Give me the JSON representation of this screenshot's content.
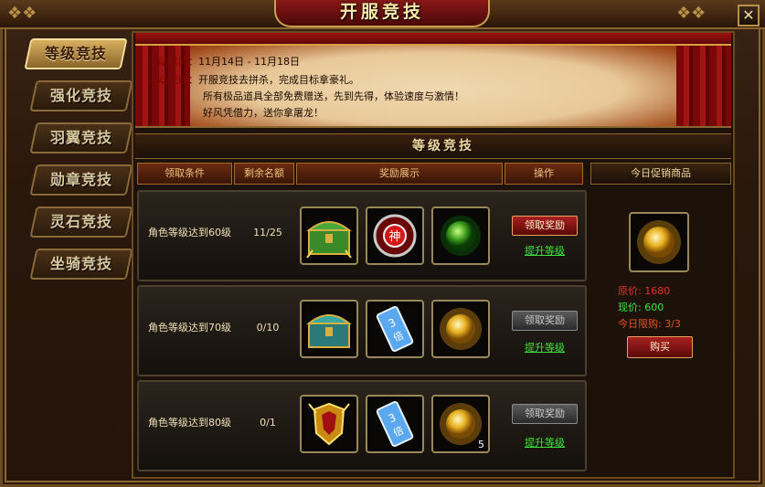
{
  "window": {
    "title": "开服竞技",
    "close": "✕"
  },
  "tabs": [
    {
      "label": "等级竞技",
      "active": true
    },
    {
      "label": "强化竞技"
    },
    {
      "label": "羽翼竞技"
    },
    {
      "label": "勋章竞技"
    },
    {
      "label": "灵石竞技"
    },
    {
      "label": "坐骑竞技"
    }
  ],
  "banner": {
    "time_label": "活动时间：",
    "time_value": "11月14日 - 11月18日",
    "desc_label": "活动说明：",
    "desc_lines": [
      "开服竞技去拼杀，完成目标拿豪礼。",
      "所有极品道具全部免费赠送，先到先得，体验速度与激情！",
      "好风凭借力，送你拿屠龙！"
    ]
  },
  "section": {
    "title": "等级竞技"
  },
  "columns": [
    "领取条件",
    "剩余名额",
    "奖励展示",
    "操作"
  ],
  "rows": [
    {
      "condition": "角色等级达到60级",
      "remaining": "11/25",
      "rewards": [
        {
          "icon": "green-treasure-chest-icon"
        },
        {
          "icon": "red-god-seal-icon"
        },
        {
          "icon": "green-orb-icon"
        }
      ],
      "claim_label": "领取奖励",
      "claim_enabled": true,
      "upgrade_label": "提升等级"
    },
    {
      "condition": "角色等级达到70级",
      "remaining": "0/10",
      "rewards": [
        {
          "icon": "cyan-treasure-chest-icon"
        },
        {
          "icon": "triple-exp-card-icon"
        },
        {
          "icon": "golden-orb-icon"
        }
      ],
      "claim_label": "领取奖励",
      "claim_enabled": false,
      "upgrade_label": "提升等级"
    },
    {
      "condition": "角色等级达到80级",
      "remaining": "0/1",
      "rewards": [
        {
          "icon": "golden-armor-icon"
        },
        {
          "icon": "triple-exp-card-icon"
        },
        {
          "icon": "golden-orb-icon",
          "count": "5"
        }
      ],
      "claim_label": "领取奖励",
      "claim_enabled": false,
      "upgrade_label": "提升等级"
    }
  ],
  "shop": {
    "title": "今日促销商品",
    "item_icon": "golden-orb-icon",
    "original_price": "原价: 1680",
    "current_price": "现价: 600",
    "limit": "今日限购: 3/3",
    "buy_label": "购买"
  },
  "colors": {
    "accent_gold": "#c8a050",
    "price_red": "#e83030",
    "price_green": "#3ae83a",
    "link_green": "#3ae83a"
  }
}
